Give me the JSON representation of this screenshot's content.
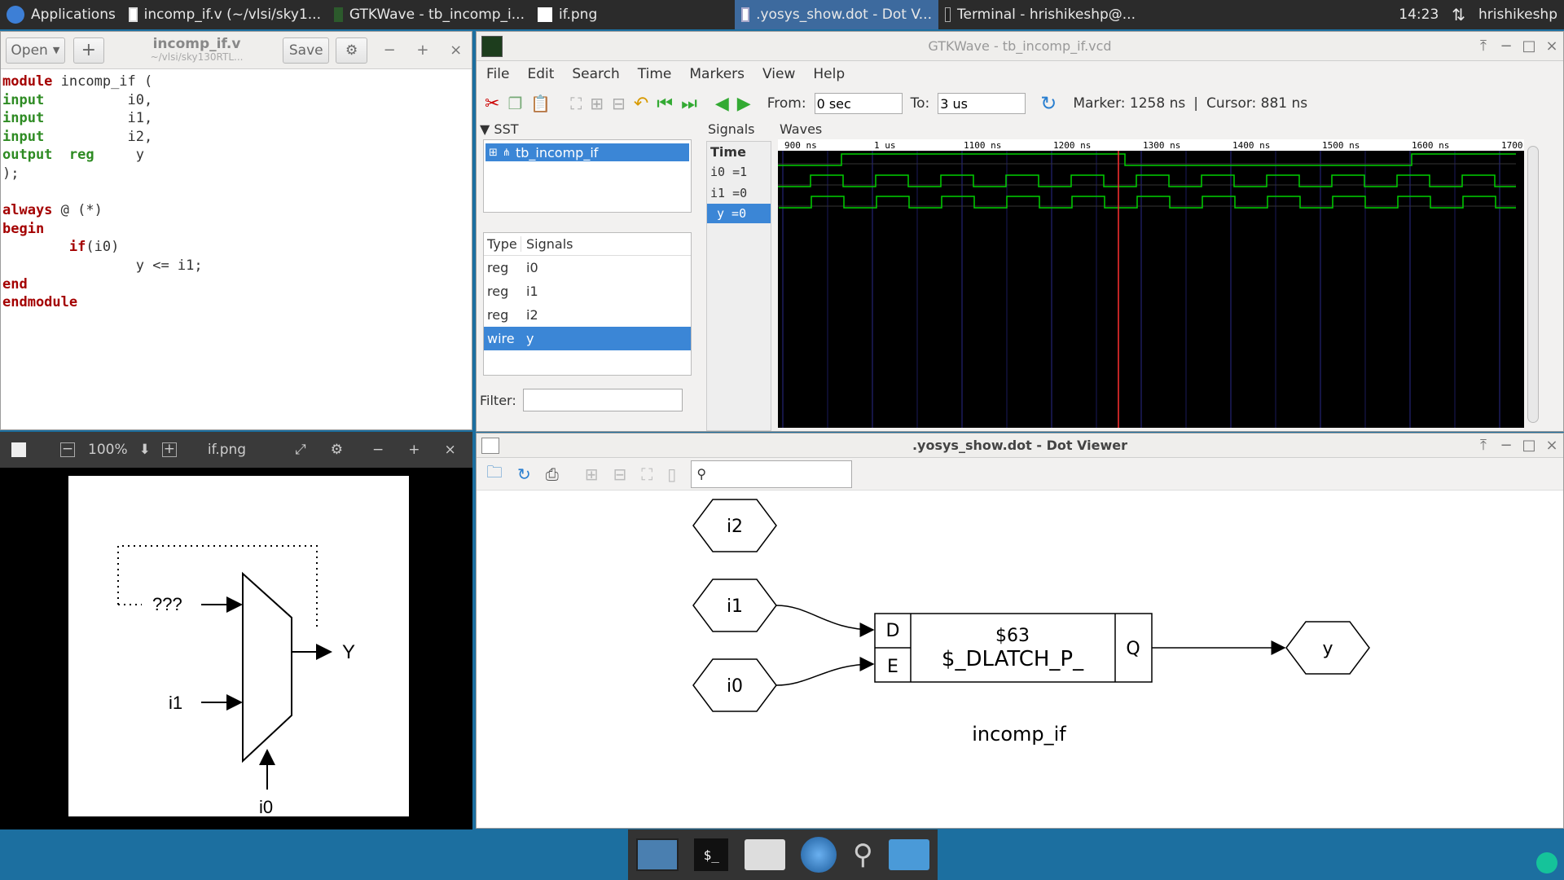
{
  "taskbar": {
    "apps_label": "Applications",
    "tasks": [
      {
        "label": "incomp_if.v (~/vlsi/sky1..."
      },
      {
        "label": "GTKWave - tb_incomp_i..."
      },
      {
        "label": "if.png"
      },
      {
        "label": ".yosys_show.dot - Dot V..."
      },
      {
        "label": "Terminal - hrishikeshp@..."
      }
    ],
    "clock": "14:23",
    "user": "hrishikeshp"
  },
  "editor": {
    "open_label": "Open",
    "save_label": "Save",
    "title": "incomp_if.v",
    "subtitle": "~/vlsi/sky130RTL...",
    "code": [
      [
        [
          "kw",
          "module"
        ],
        [
          "t",
          " incomp_if ("
        ]
      ],
      [
        [
          "ty",
          "input"
        ],
        [
          "t",
          "          i0,"
        ]
      ],
      [
        [
          "ty",
          "input"
        ],
        [
          "t",
          "          i1,"
        ]
      ],
      [
        [
          "ty",
          "input"
        ],
        [
          "t",
          "          i2,"
        ]
      ],
      [
        [
          "ty",
          "output"
        ],
        [
          "t",
          "  "
        ],
        [
          "ty",
          "reg"
        ],
        [
          "t",
          "     y"
        ]
      ],
      [
        [
          "t",
          ");"
        ]
      ],
      [
        [
          "t",
          ""
        ]
      ],
      [
        [
          "kw",
          "always"
        ],
        [
          "t",
          " @ (*)"
        ]
      ],
      [
        [
          "kw",
          "begin"
        ]
      ],
      [
        [
          "t",
          "        "
        ],
        [
          "kw",
          "if"
        ],
        [
          "t",
          "(i0)"
        ]
      ],
      [
        [
          "t",
          "                y <= i1;"
        ]
      ],
      [
        [
          "kw",
          "end"
        ]
      ],
      [
        [
          "kw",
          "endmodule"
        ]
      ]
    ]
  },
  "viewer": {
    "zoom": "100%",
    "title": "if.png",
    "diagram": {
      "unknown": "???",
      "output": "Y",
      "input_i1": "i1",
      "select": "i0"
    }
  },
  "gtkwave": {
    "title": "GTKWave - tb_incomp_if.vcd",
    "menu": [
      "File",
      "Edit",
      "Search",
      "Time",
      "Markers",
      "View",
      "Help"
    ],
    "from_label": "From:",
    "from_value": "0 sec",
    "to_label": "To:",
    "to_value": "3 us",
    "marker": "Marker: 1258 ns",
    "cursor": "Cursor: 881 ns",
    "sst_label": "SST",
    "tree_root": "tb_incomp_if",
    "type_header": "Type",
    "signals_header": "Signals",
    "signals": [
      {
        "type": "reg",
        "name": "i0"
      },
      {
        "type": "reg",
        "name": "i1"
      },
      {
        "type": "reg",
        "name": "i2"
      },
      {
        "type": "wire",
        "name": "y"
      }
    ],
    "filter_label": "Filter:",
    "signals_panel_label": "Signals",
    "time_label": "Time",
    "values": [
      "i0 =1",
      "i1 =0",
      "y =0"
    ],
    "waves_label": "Waves",
    "ticks": [
      "900 ns",
      "1 us",
      "1100 ns",
      "1200 ns",
      "1300 ns",
      "1400 ns",
      "1500 ns",
      "1600 ns",
      "1700"
    ],
    "wave_color": "#00d000",
    "marker_color": "#ff3030"
  },
  "dot": {
    "title": ".yosys_show.dot - Dot Viewer",
    "search_placeholder": "",
    "nodes": {
      "i2": "i2",
      "i1": "i1",
      "i0": "i0",
      "y": "y"
    },
    "cell": {
      "id": "$63",
      "type": "$_DLATCH_P_",
      "port_d": "D",
      "port_e": "E",
      "port_q": "Q"
    },
    "module_name": "incomp_if"
  }
}
